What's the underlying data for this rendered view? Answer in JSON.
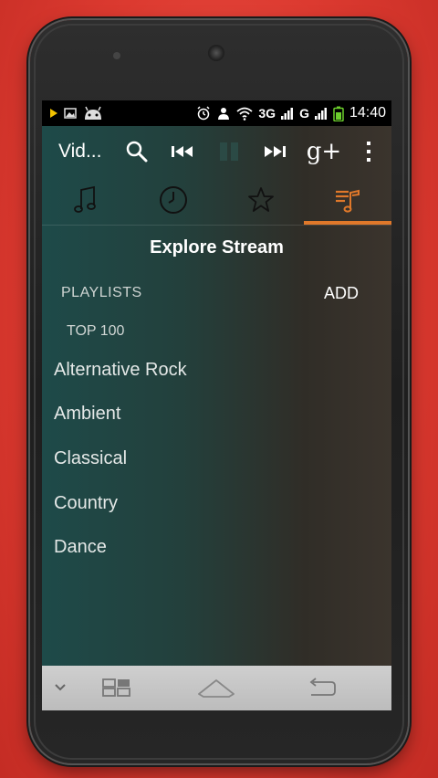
{
  "status_bar": {
    "time": "14:40",
    "network": "3G",
    "network2": "G",
    "icons": [
      "play-icon",
      "image-icon",
      "android-icon",
      "alarm-icon",
      "account-icon",
      "wifi-icon",
      "signal-icon",
      "battery-icon"
    ]
  },
  "top_bar": {
    "title": "Vid...",
    "icons": [
      "search-icon",
      "previous-icon",
      "pause-icon",
      "next-icon",
      "google-plus-icon",
      "overflow-menu-icon"
    ],
    "google_plus_label": "g+"
  },
  "tabs": [
    {
      "name": "music",
      "icon": "music-note-icon"
    },
    {
      "name": "history",
      "icon": "clock-icon"
    },
    {
      "name": "favorites",
      "icon": "star-icon"
    },
    {
      "name": "explore",
      "icon": "playlist-icon",
      "active": true
    }
  ],
  "main": {
    "title": "Explore Stream",
    "playlists_label": "PLAYLISTS",
    "add_label": "ADD",
    "top_label": "TOP 100",
    "genres": [
      "Alternative Rock",
      "Ambient",
      "Classical",
      "Country",
      "Dance"
    ]
  },
  "nav_bar": {
    "icons": [
      "collapse-icon",
      "recent-apps-icon",
      "home-icon",
      "back-icon"
    ]
  },
  "colors": {
    "accent": "#e0782a",
    "background_left": "#1e4a49",
    "background_right": "#3b342d"
  }
}
